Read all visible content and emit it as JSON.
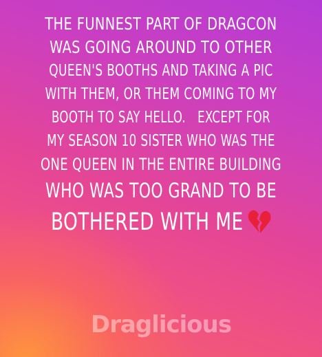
{
  "story": {
    "lines": [
      "THE FUNNEST PART OF DRAGCON",
      "WAS GOING AROUND TO OTHER",
      "QUEEN'S BOOTHS AND TAKING A PIC",
      "WITH THEM, OR THEM COMING TO MY",
      "BOOTH TO SAY HELLO.   EXCEPT FOR",
      "MY SEASON 10 SISTER WHO WAS THE",
      "ONE QUEEN IN THE ENTIRE BUILDING",
      "WHO WAS TOO GRAND TO BE",
      "BOTHERED WITH ME"
    ],
    "emoji": "broken-heart-icon",
    "heart_color": "#e8203a"
  },
  "watermark": {
    "text": "Draglicious"
  },
  "colors": {
    "gradient_top": "#b43ad6",
    "gradient_mid": "#e44597",
    "gradient_bottom_left": "#ff9a3c",
    "text": "#ffffff"
  }
}
